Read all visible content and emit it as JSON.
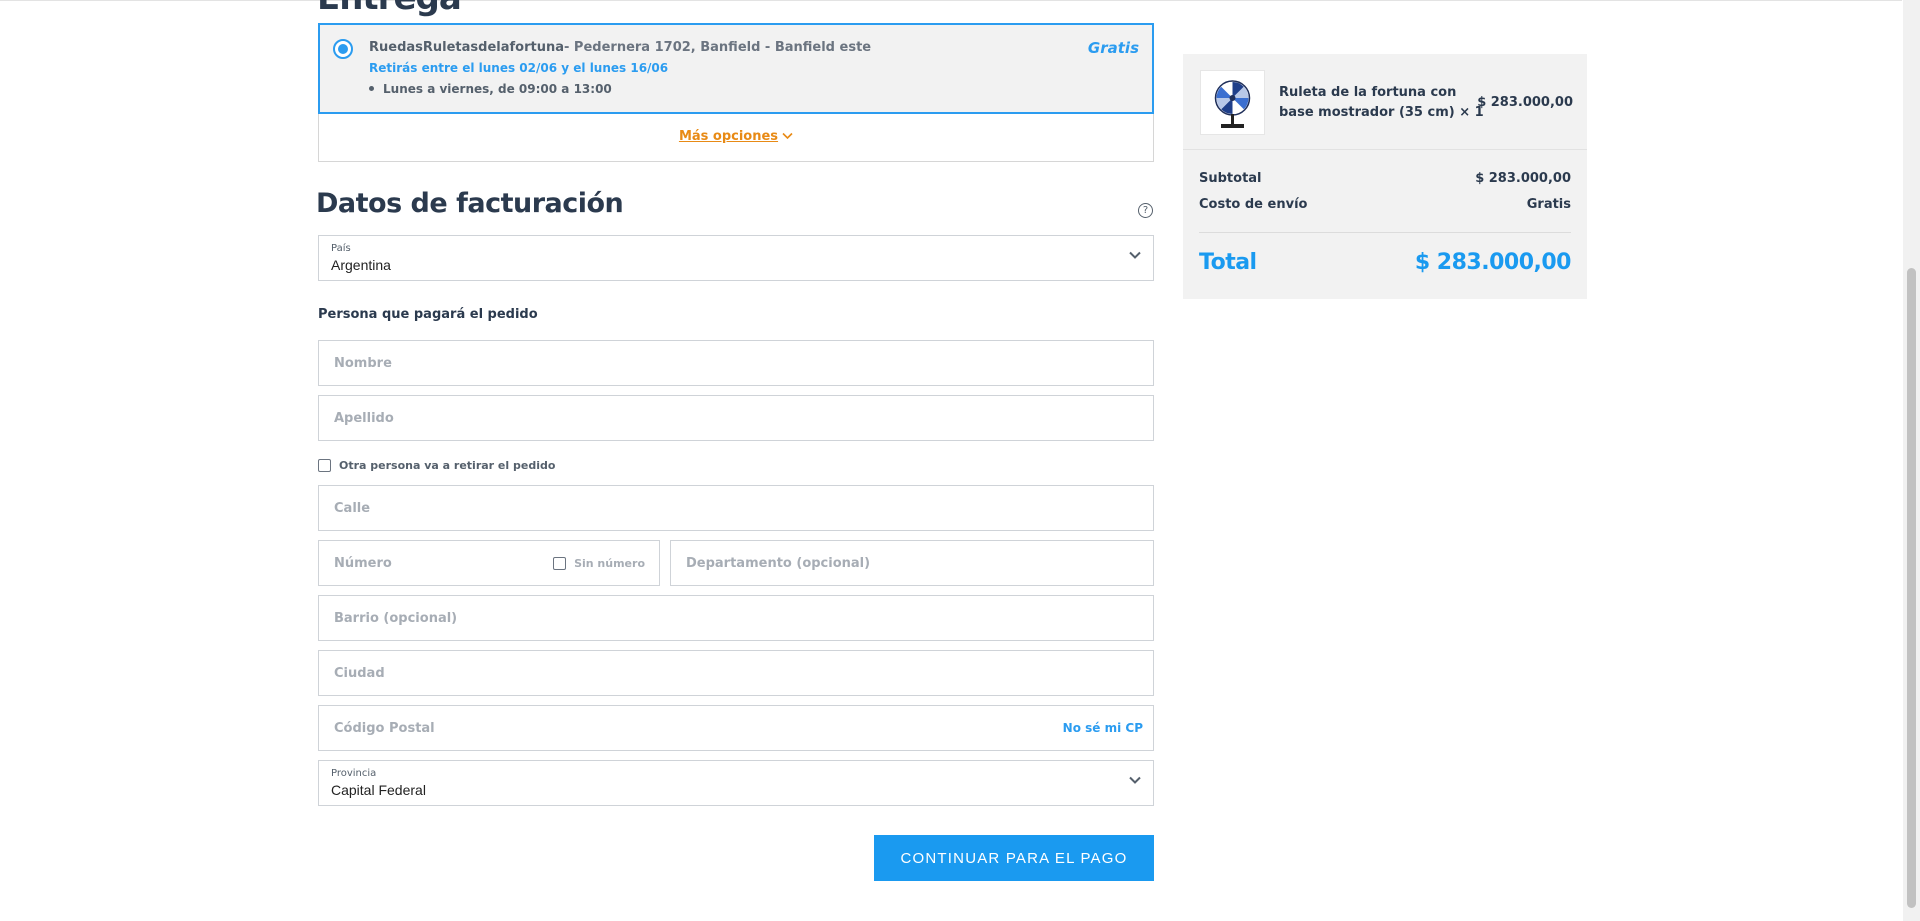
{
  "header": {
    "partial_title": "Entrega"
  },
  "shipping": {
    "store_name": "RuedasRuletasdelafortuna",
    "address": "- Pedernera 1702, Banfield - Banfield este",
    "pickup_window": "Retirás entre el lunes 02/06 y el lunes 16/06",
    "hours": "Lunes a viernes, de 09:00 a 13:00",
    "price": "Gratis",
    "more_options": "Más opciones"
  },
  "billing": {
    "title": "Datos de facturación",
    "country": {
      "label": "País",
      "value": "Argentina"
    },
    "payer_label": "Persona que pagará el pedido",
    "fields": {
      "nombre": "Nombre",
      "apellido": "Apellido",
      "calle": "Calle",
      "numero": "Número",
      "departamento": "Departamento (opcional)",
      "barrio": "Barrio (opcional)",
      "ciudad": "Ciudad",
      "codigo_postal": "Código Postal"
    },
    "other_person_label": "Otra persona va a retirar el pedido",
    "sin_numero_label": "Sin número",
    "cp_link": "No sé mi CP",
    "province": {
      "label": "Provincia",
      "value": "Capital Federal"
    },
    "continue_button": "CONTINUAR PARA EL PAGO"
  },
  "summary": {
    "item": {
      "name": "Ruleta de la fortuna con base mostrador (35 cm) × 1",
      "price": "$ 283.000,00"
    },
    "subtotal_label": "Subtotal",
    "subtotal_value": "$ 283.000,00",
    "shipping_label": "Costo de envío",
    "shipping_value": "Gratis",
    "total_label": "Total",
    "total_value": "$ 283.000,00"
  },
  "colors": {
    "accent": "#1a9af0",
    "link_orange": "#e88a15",
    "text_dark": "#2b3a4e"
  },
  "icons": [
    "radio-selected-icon",
    "chevron-down-icon",
    "help-icon",
    "product-thumbnail"
  ]
}
